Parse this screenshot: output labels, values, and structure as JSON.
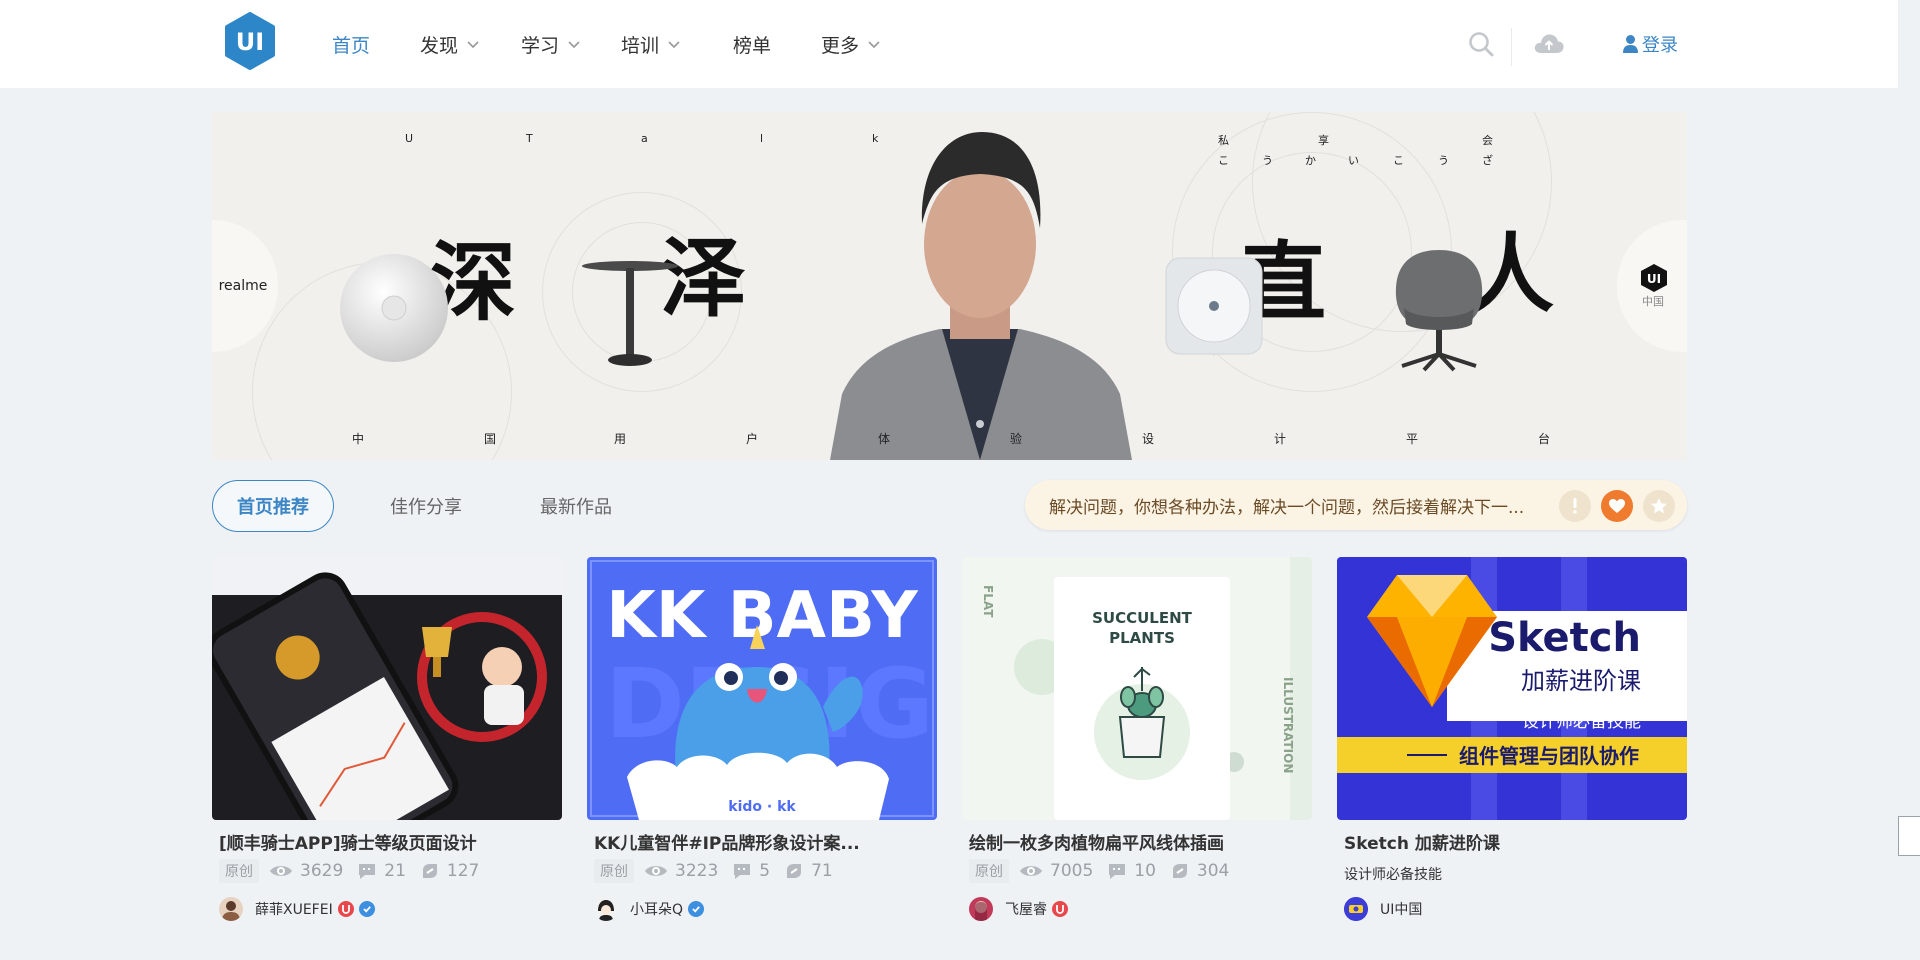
{
  "nav": {
    "items": [
      {
        "label": "首页",
        "active": true,
        "dropdown": false
      },
      {
        "label": "发现",
        "active": false,
        "dropdown": true
      },
      {
        "label": "学习",
        "active": false,
        "dropdown": true
      },
      {
        "label": "培训",
        "active": false,
        "dropdown": true
      },
      {
        "label": "榜单",
        "active": false,
        "dropdown": false
      },
      {
        "label": "更多",
        "active": false,
        "dropdown": true
      }
    ],
    "login_label": "登录",
    "icons": [
      "search-icon",
      "cloud-upload-icon",
      "user-icon"
    ]
  },
  "logo": {
    "text": "UI"
  },
  "banner": {
    "utalk_letters": [
      "U",
      "T",
      "a",
      "l",
      "k"
    ],
    "private_club": [
      "私",
      "享",
      "会"
    ],
    "kana": [
      "こ",
      "う",
      "か",
      "い",
      "こ",
      "う",
      "ざ"
    ],
    "calligraphy": [
      "深",
      "泽",
      "直",
      "人"
    ],
    "footer_chars": [
      "中",
      "国",
      "用",
      "户",
      "体",
      "验",
      "设",
      "计",
      "平",
      "台"
    ],
    "left_brand": "realme",
    "right_brand": {
      "logo": "UI",
      "sub": "中国"
    }
  },
  "tabs": [
    {
      "label": "首页推荐",
      "active": true
    },
    {
      "label": "佳作分享",
      "active": false
    },
    {
      "label": "最新作品",
      "active": false
    }
  ],
  "quote": {
    "text": "解决问题，你想各种办法，解决一个问题，然后接着解决下一...",
    "icons": [
      "alert-icon",
      "heart-icon",
      "star-icon"
    ]
  },
  "cards": [
    {
      "title": "[顺丰骑士APP]骑士等级页面设计",
      "tag": "原创",
      "views": "3629",
      "comments": "21",
      "likes": "127",
      "author": "薛菲XUEFEI",
      "badges": [
        "u-badge",
        "verified-badge"
      ]
    },
    {
      "title": "KK儿童智伴#IP品牌形象设计案...",
      "tag": "原创",
      "views": "3223",
      "comments": "5",
      "likes": "71",
      "author": "小耳朵Q",
      "badges": [
        "verified-badge"
      ],
      "image_text": {
        "headline": "KK BABY",
        "bg": "DESIGN",
        "brand": "kido · kk"
      }
    },
    {
      "title": "绘制一枚多肉植物扁平风线体插画",
      "tag": "原创",
      "views": "7005",
      "comments": "10",
      "likes": "304",
      "author": "飞屋睿",
      "badges": [
        "u-badge"
      ],
      "image_text": {
        "top": "FLAT",
        "side": "ILLUSTRATION",
        "card": [
          "SUCCULENT",
          "PLANTS"
        ]
      }
    },
    {
      "title": "Sketch 加薪进阶课",
      "subtitle": "设计师必备技能",
      "author": "UI中国",
      "badges": [],
      "image_text": {
        "brand": "Sketch",
        "line1": "加薪进阶课",
        "line2": "设计师必备技能",
        "banner": "组件管理与团队协作"
      }
    }
  ],
  "colors": {
    "accent": "#3d86c6",
    "page_bg": "#eef2f5",
    "quote_bg": "#fbf3e4",
    "badge_red": "#e8474b",
    "badge_blue": "#3d8fe0",
    "heart_orange": "#ee7b2e"
  }
}
